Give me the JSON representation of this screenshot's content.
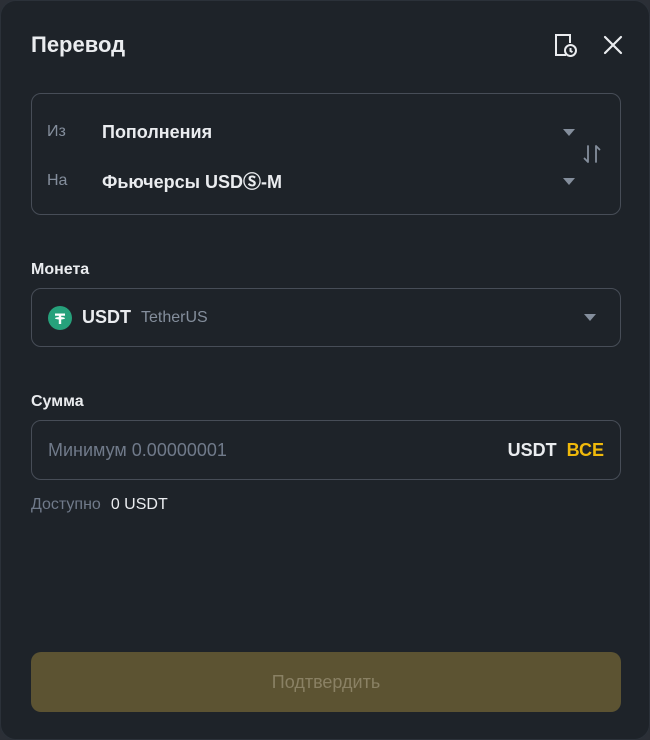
{
  "modal": {
    "title": "Перевод",
    "history_icon": "history-icon",
    "close_icon": "close-icon"
  },
  "transfer": {
    "from_label": "Из",
    "from_value": "Пополнения",
    "to_label": "На",
    "to_value": "Фьючерсы USDⓈ-M",
    "swap_icon": "swap-icon"
  },
  "coin": {
    "label": "Монета",
    "symbol": "USDT",
    "name": "TetherUS",
    "logo_color": "#26a17b"
  },
  "amount": {
    "label": "Сумма",
    "placeholder": "Минимум 0.00000001",
    "value": "",
    "unit": "USDT",
    "max_label": "ВСЕ"
  },
  "available": {
    "label": "Доступно",
    "value": "0 USDT"
  },
  "confirm_label": "Подтвердить",
  "colors": {
    "accent": "#f0b90b",
    "background": "#1e2329",
    "border": "#474d57",
    "button_disabled": "#5c5332"
  }
}
